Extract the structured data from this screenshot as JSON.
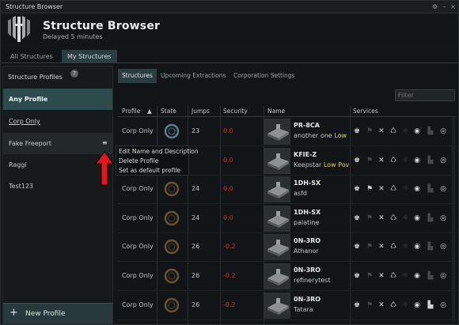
{
  "window": {
    "title": "Structure Browser"
  },
  "header": {
    "title": "Structure Browser",
    "subtitle": "Delayed 5 minutes"
  },
  "top_tabs": [
    {
      "label": "All Structures",
      "active": false
    },
    {
      "label": "My Structures",
      "active": true
    }
  ],
  "sidebar": {
    "title": "Structure Profiles",
    "help": "?",
    "profiles": [
      {
        "label": "Any Profile",
        "selected": true
      },
      {
        "label": "Corp Only",
        "selected": false
      },
      {
        "label": "Fake Freeport",
        "selected": false
      },
      {
        "label": "Raggi",
        "selected": false
      },
      {
        "label": "Test123",
        "selected": false
      }
    ],
    "new_profile": "New Profile"
  },
  "sub_tabs": [
    {
      "label": "Structures",
      "active": true
    },
    {
      "label": "Upcoming Extractions",
      "active": false
    },
    {
      "label": "Corporation Settings",
      "active": false
    }
  ],
  "filter": {
    "placeholder": "Filter"
  },
  "table": {
    "headers": [
      "Profile",
      "State",
      "Jumps",
      "Security",
      "Name",
      "Services"
    ],
    "rows": [
      {
        "profile": "Corp Only",
        "jumps": "23",
        "security": "0.0",
        "name": "PR-8CA",
        "type": "another one",
        "low_power": "Low"
      },
      {
        "profile": "",
        "jumps": "",
        "security": "0.0",
        "name": "KFIE-Z",
        "type": "Keepstar",
        "low_power": "Low Pov"
      },
      {
        "profile": "Corp Only",
        "jumps": "24",
        "security": "0.0",
        "name": "1DH-SX",
        "type": "asfd",
        "low_power": ""
      },
      {
        "profile": "Corp Only",
        "jumps": "24",
        "security": "0.0",
        "name": "1DH-SX",
        "type": "palatine",
        "low_power": ""
      },
      {
        "profile": "Corp Only",
        "jumps": "26",
        "security": "-0.2",
        "name": "0N-3RO",
        "type": "Athanor",
        "low_power": ""
      },
      {
        "profile": "Corp Only",
        "jumps": "26",
        "security": "-0.2",
        "name": "0N-3RO",
        "type": "refinerytest",
        "low_power": ""
      },
      {
        "profile": "Corp Only",
        "jumps": "26",
        "security": "-0.2",
        "name": "0N-3RO",
        "type": "Tatara",
        "low_power": ""
      }
    ]
  },
  "context_menu": {
    "items": [
      "Edit Name and Description",
      "Delete Profile",
      "Set as default profile"
    ]
  },
  "colors": {
    "accent": "#2d4a4c",
    "security_negative": "#d92a22",
    "low_power": "#e7d44a",
    "annotation_arrow": "#e3161b"
  }
}
